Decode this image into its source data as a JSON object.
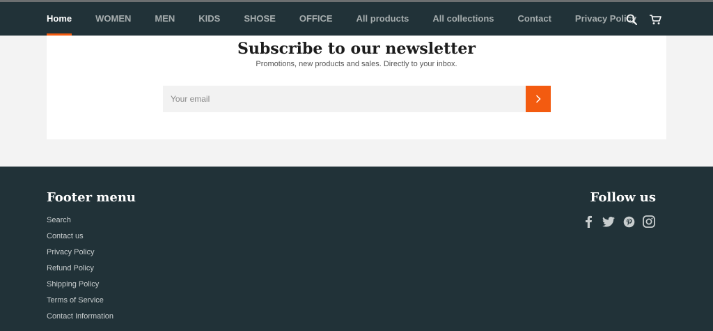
{
  "nav": {
    "items": [
      {
        "label": "Home",
        "active": true
      },
      {
        "label": "WOMEN"
      },
      {
        "label": "MEN"
      },
      {
        "label": "KIDS"
      },
      {
        "label": "SHOSE"
      },
      {
        "label": "OFFICE"
      },
      {
        "label": "All products"
      },
      {
        "label": "All collections"
      },
      {
        "label": "Contact"
      },
      {
        "label": "Privacy Policy"
      }
    ],
    "icons": [
      "search-icon",
      "cart-icon"
    ]
  },
  "newsletter": {
    "title": "Subscribe to our newsletter",
    "subtitle": "Promotions, new products and sales. Directly to your inbox.",
    "email_placeholder": "Your email",
    "submit_icon": "chevron-right-icon"
  },
  "footer": {
    "menu_title": "Footer menu",
    "menu_items": [
      "Search",
      "Contact us",
      "Privacy Policy",
      "Refund Policy",
      "Shipping Policy",
      "Terms of Service",
      "Contact Information"
    ],
    "follow_title": "Follow us",
    "social_icons": [
      "facebook-icon",
      "twitter-icon",
      "pinterest-icon",
      "instagram-icon"
    ]
  },
  "colors": {
    "header_bg": "#213238",
    "accent": "#f35b10",
    "page_bg": "#f3f3f3"
  }
}
